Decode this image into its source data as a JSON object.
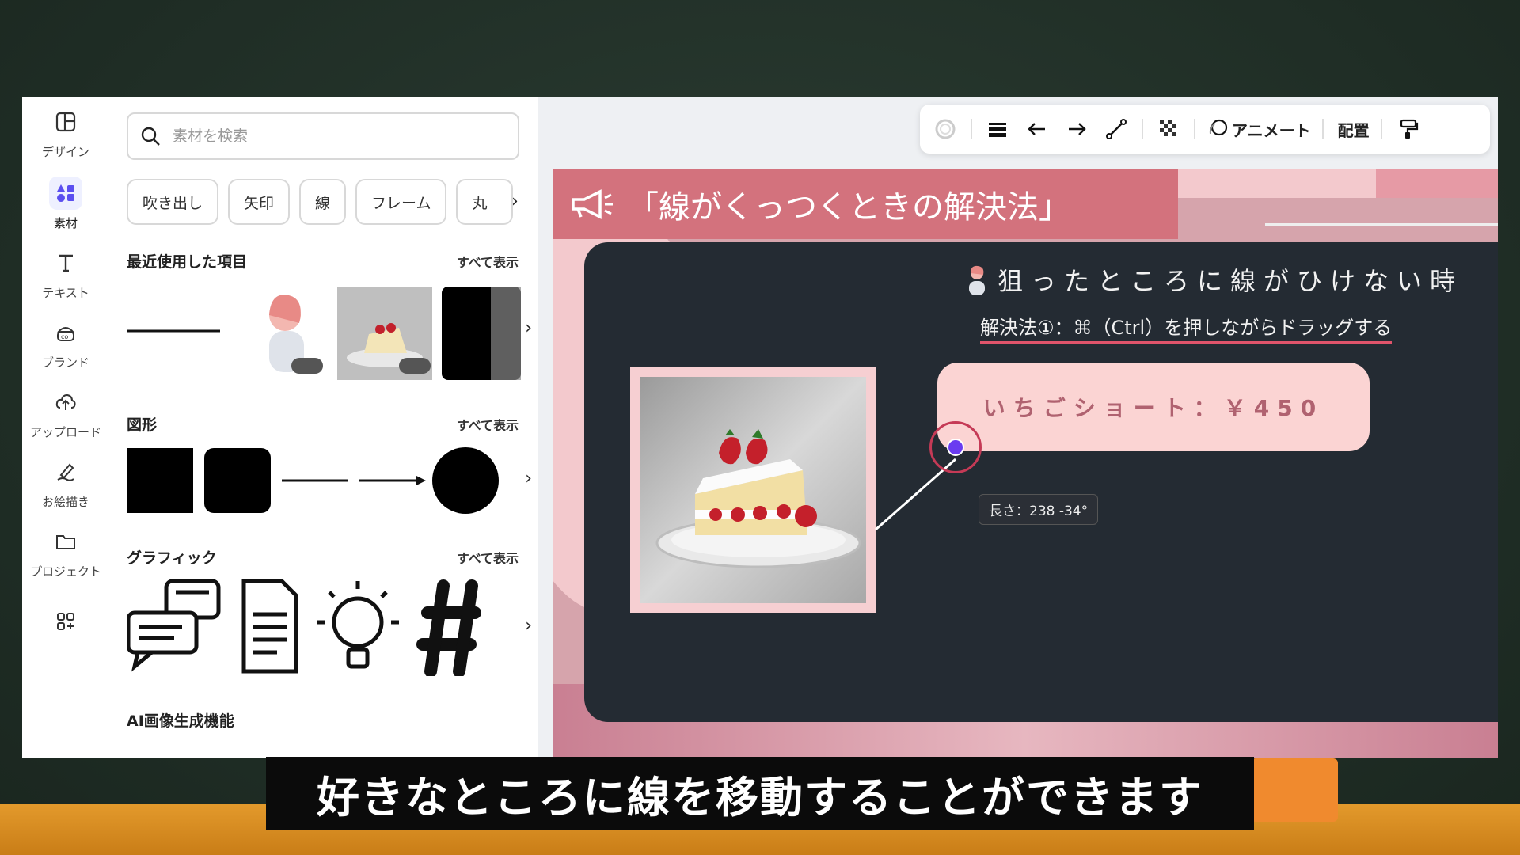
{
  "rail": {
    "items": [
      {
        "label": "デザイン",
        "icon": "layout-icon"
      },
      {
        "label": "素材",
        "icon": "elements-icon"
      },
      {
        "label": "テキスト",
        "icon": "text-icon"
      },
      {
        "label": "ブランド",
        "icon": "brand-icon"
      },
      {
        "label": "アップロード",
        "icon": "upload-icon"
      },
      {
        "label": "お絵描き",
        "icon": "draw-icon"
      },
      {
        "label": "プロジェクト",
        "icon": "folder-icon"
      },
      {
        "label": "",
        "icon": "apps-icon"
      }
    ]
  },
  "panel": {
    "search_placeholder": "素材を検索",
    "chips": [
      "吹き出し",
      "矢印",
      "線",
      "フレーム",
      "丸"
    ],
    "sections": {
      "recent": {
        "title": "最近使用した項目",
        "see_all": "すべて表示"
      },
      "shapes": {
        "title": "図形",
        "see_all": "すべて表示"
      },
      "graphics": {
        "title": "グラフィック",
        "see_all": "すべて表示"
      },
      "ai": {
        "title": "AI画像生成機能"
      }
    }
  },
  "toolbar": {
    "animate_label": "アニメート",
    "arrange_label": "配置"
  },
  "slide": {
    "title": "「線がくっつくときの解決法」",
    "subtitle": "狙ったところに線がひけない時",
    "solution": "解決法①：⌘（Ctrl）を押しながらドラッグする",
    "price": "いちごショート：￥450",
    "tooltip": "長さ：238 -34°"
  },
  "caption": "好きなところに線を移動することができます",
  "colors": {
    "title_band": "#d3727d",
    "slide_dark": "#242b33",
    "price_box": "#fbd4d3",
    "accent_purple": "#6a3cf0"
  }
}
